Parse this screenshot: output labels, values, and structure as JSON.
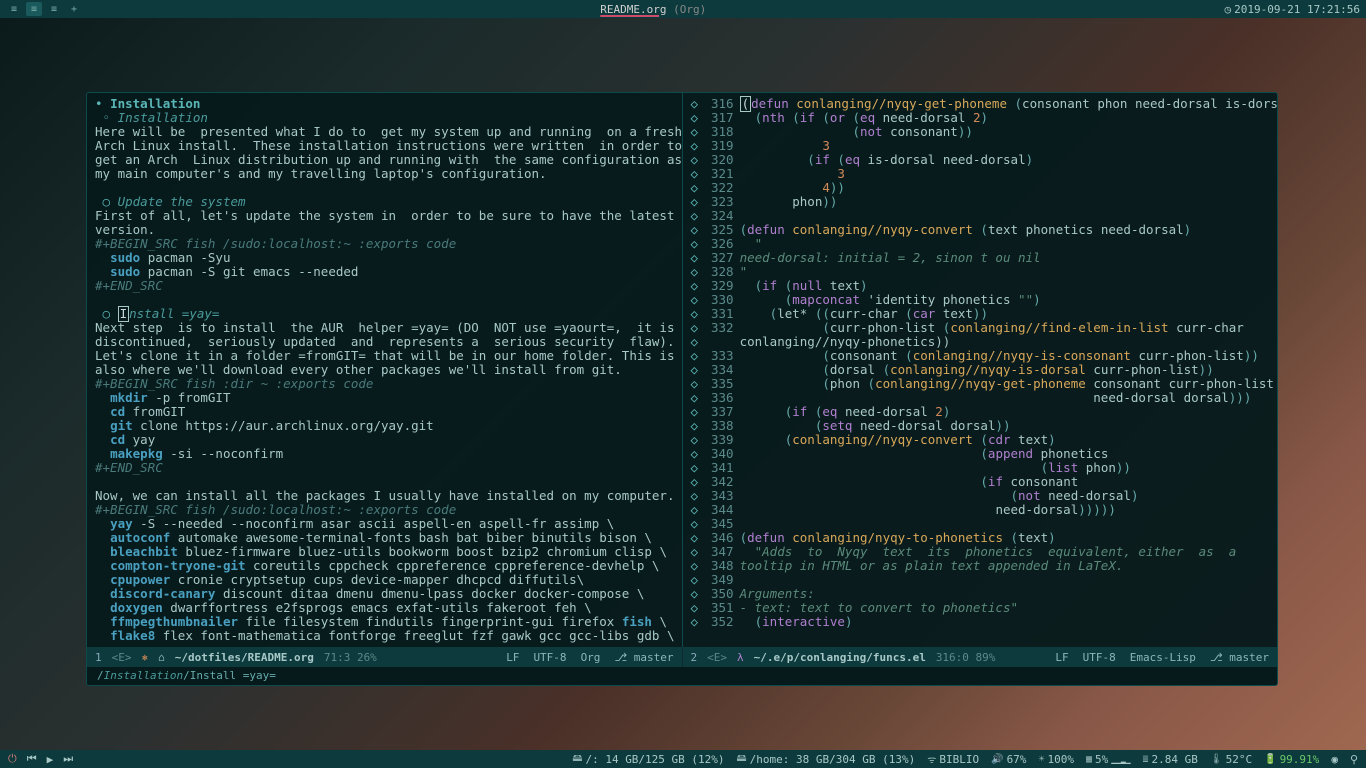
{
  "topbar": {
    "title": "README.org",
    "mode": "(Org)",
    "datetime": "2019-09-21 17:21:56"
  },
  "left_pane": {
    "h_installation1": "Installation",
    "h_installation2": "Installation",
    "p_intro": "Here will be  presented what I do to  get my system up and running  on a fresh\nArch Linux install.  These installation instructions were written  in order to\nget an Arch  Linux distribution up and running with  the same configuration as\nmy main computer's and my travelling laptop's configuration.",
    "h_update": "Update the system",
    "p_update": "First of all, let's update the system in  order to be sure to have the latest\nversion.",
    "src1_hdr": "#+BEGIN_SRC fish /sudo:localhost:~ :exports code",
    "src1_l1a": "sudo",
    "src1_l1b": " pacman -Syu",
    "src1_l2a": "sudo",
    "src1_l2b": " pacman -S git emacs --needed",
    "src_end": "#+END_SRC",
    "h_install_yay_pre": "nstall =yay=",
    "p_yay": "Next step  is to install  the AUR  helper =yay= (DO  NOT use =yaourt=,  it is\ndiscontinued,  seriously updated  and  represents a  serious security  flaw).\nLet's clone it in a folder =fromGIT= that will be in our home folder. This is\nalso where we'll download every other packages we'll install from git.",
    "src2_hdr": "#+BEGIN_SRC fish :dir ~ :exports code",
    "src2_l1a": "mkdir",
    "src2_l1b": " -p fromGIT",
    "src2_l2a": "cd",
    "src2_l2b": " fromGIT",
    "src2_l3a": "git",
    "src2_l3b": " clone https://aur.archlinux.org/yay.git",
    "src2_l4a": "cd",
    "src2_l4b": " yay",
    "src2_l5a": "makepkg",
    "src2_l5b": " -si --noconfirm",
    "p_packages": "Now, we can install all the packages I usually have installed on my computer.",
    "src3_hdr": "#+BEGIN_SRC fish /sudo:localhost:~ :exports code",
    "pkg_l1a": "yay",
    "pkg_l1b": " -S --needed --noconfirm asar ascii aspell-en aspell-fr assimp \\",
    "pkg_l2a": "autoconf",
    "pkg_l2b": " automake awesome-terminal-fonts bash bat biber binutils bison \\",
    "pkg_l3a": "bleachbit",
    "pkg_l3b": " bluez-firmware bluez-utils bookworm boost bzip2 chromium clisp \\",
    "pkg_l4a": "compton-tryone-git",
    "pkg_l4b": " coreutils cppcheck cppreference cppreference-devhelp \\",
    "pkg_l5a": "cpupower",
    "pkg_l5b": " cronie cryptsetup cups device-mapper dhcpcd diffutils\\",
    "pkg_l6a": "discord-canary",
    "pkg_l6b": " discount ditaa dmenu dmenu-lpass docker docker-compose \\",
    "pkg_l7a": "doxygen",
    "pkg_l7b": " dwarffortress e2fsprogs emacs exfat-utils fakeroot feh \\",
    "pkg_l8a": "ffmpegthumbnailer",
    "pkg_l8b": " file filesystem findutils fingerprint-gui firefox ",
    "pkg_l8c": "fish",
    "pkg_l8d": " \\",
    "pkg_l9a": "flake8",
    "pkg_l9b": " flex font-mathematica fontforge freeglut fzf gawk gcc gcc-libs gdb \\"
  },
  "right_pane": {
    "lines": [
      {
        "n": "316",
        "c": "(defun conlanging//nyqy-get-phoneme (consonant phon need-dorsal is-dorsal)",
        "class": "code"
      },
      {
        "n": "317",
        "c": "  (nth (if (or (eq need-dorsal 2)",
        "class": "code"
      },
      {
        "n": "318",
        "c": "               (not consonant))",
        "class": "code"
      },
      {
        "n": "319",
        "c": "           3",
        "class": "code"
      },
      {
        "n": "320",
        "c": "         (if (eq is-dorsal need-dorsal)",
        "class": "code"
      },
      {
        "n": "321",
        "c": "             3",
        "class": "code"
      },
      {
        "n": "322",
        "c": "           4))",
        "class": "code"
      },
      {
        "n": "323",
        "c": "       phon))",
        "class": "code"
      },
      {
        "n": "324",
        "c": "",
        "class": "code"
      },
      {
        "n": "325",
        "c": "(defun conlanging//nyqy-convert (text phonetics need-dorsal)",
        "class": "code"
      },
      {
        "n": "326",
        "c": "  \"",
        "class": "str"
      },
      {
        "n": "327",
        "c": "need-dorsal: initial = 2, sinon t ou nil",
        "class": "str"
      },
      {
        "n": "328",
        "c": "\"",
        "class": "str"
      },
      {
        "n": "329",
        "c": "  (if (null text)",
        "class": "code"
      },
      {
        "n": "330",
        "c": "      (mapconcat 'identity phonetics \"\")",
        "class": "code"
      },
      {
        "n": "331",
        "c": "    (let* ((curr-char (car text))",
        "class": "code"
      },
      {
        "n": "332",
        "c": "           (curr-phon-list (conlanging//find-elem-in-list curr-char",
        "class": "code"
      },
      {
        "n": "",
        "c": "conlanging//nyqy-phonetics))",
        "class": "code-cont"
      },
      {
        "n": "333",
        "c": "           (consonant (conlanging//nyqy-is-consonant curr-phon-list))",
        "class": "code"
      },
      {
        "n": "334",
        "c": "           (dorsal (conlanging//nyqy-is-dorsal curr-phon-list))",
        "class": "code"
      },
      {
        "n": "335",
        "c": "           (phon (conlanging//nyqy-get-phoneme consonant curr-phon-list",
        "class": "code"
      },
      {
        "n": "336",
        "c": "                                               need-dorsal dorsal)))",
        "class": "code"
      },
      {
        "n": "337",
        "c": "      (if (eq need-dorsal 2)",
        "class": "code"
      },
      {
        "n": "338",
        "c": "          (setq need-dorsal dorsal))",
        "class": "code"
      },
      {
        "n": "339",
        "c": "      (conlanging//nyqy-convert (cdr text)",
        "class": "code"
      },
      {
        "n": "340",
        "c": "                                (append phonetics",
        "class": "code"
      },
      {
        "n": "341",
        "c": "                                        (list phon))",
        "class": "code"
      },
      {
        "n": "342",
        "c": "                                (if consonant",
        "class": "code"
      },
      {
        "n": "343",
        "c": "                                    (not need-dorsal)",
        "class": "code"
      },
      {
        "n": "344",
        "c": "                                  need-dorsal)))))",
        "class": "code"
      },
      {
        "n": "345",
        "c": "",
        "class": "code"
      },
      {
        "n": "346",
        "c": "(defun conlanging/nyqy-to-phonetics (text)",
        "class": "code"
      },
      {
        "n": "347",
        "c": "  \"Adds  to  Nyqy  text  its  phonetics  equivalent, either  as  a",
        "class": "str"
      },
      {
        "n": "348",
        "c": "tooltip in HTML or as plain text appended in LaTeX.",
        "class": "str"
      },
      {
        "n": "349",
        "c": "",
        "class": "str"
      },
      {
        "n": "350",
        "c": "Arguments:",
        "class": "str"
      },
      {
        "n": "351",
        "c": "- text: text to convert to phonetics\"",
        "class": "str"
      },
      {
        "n": "352",
        "c": "  (interactive)",
        "class": "code"
      }
    ]
  },
  "modeline_left": {
    "num": "1",
    "evil": "<E>",
    "path": "~/dotfiles/README.org",
    "pos": "71:3 26%",
    "lf": "LF",
    "enc": "UTF-8",
    "mode": "Org",
    "branch": "master"
  },
  "modeline_right": {
    "num": "2",
    "evil": "<E>",
    "path": "~/.e/p/conlanging/funcs.el",
    "pos": "316:0 89%",
    "lf": "LF",
    "enc": "UTF-8",
    "mode": "Emacs-Lisp",
    "branch": "master"
  },
  "minibuffer": {
    "a": "/",
    "b": "Installation",
    "c": "/Install =yay="
  },
  "bottombar": {
    "disk_root": "/: 14 GB/125 GB (12%)",
    "disk_home": "/home: 38 GB/304 GB (13%)",
    "net": "BIBLIO",
    "vol": "67%",
    "bright": "100%",
    "cpu": "5%",
    "mem": "2.84 GB",
    "temp": "52°C",
    "bat": "99.91%"
  }
}
